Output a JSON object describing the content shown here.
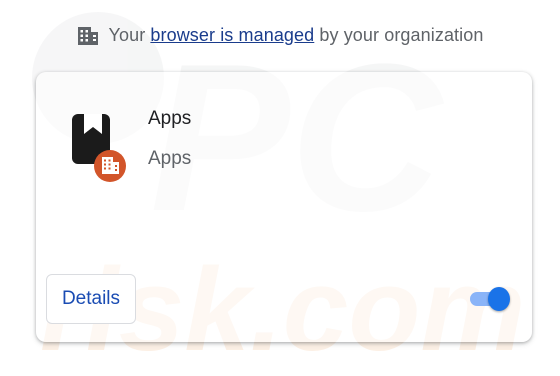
{
  "banner": {
    "prefix": "Your ",
    "link": "browser is managed",
    "suffix": " by your organization",
    "icon": "building-icon"
  },
  "extension": {
    "name": "Apps",
    "description": "Apps",
    "icon": "apps-bookmark-icon",
    "badge_icon": "managed-building-badge-icon",
    "details_label": "Details",
    "enabled": true
  },
  "watermark": {
    "text_top": "PC",
    "text_bottom": "risk.com"
  },
  "colors": {
    "link": "#1a3c8c",
    "toggle_on": "#1a73e8",
    "badge": "#d2552a"
  }
}
